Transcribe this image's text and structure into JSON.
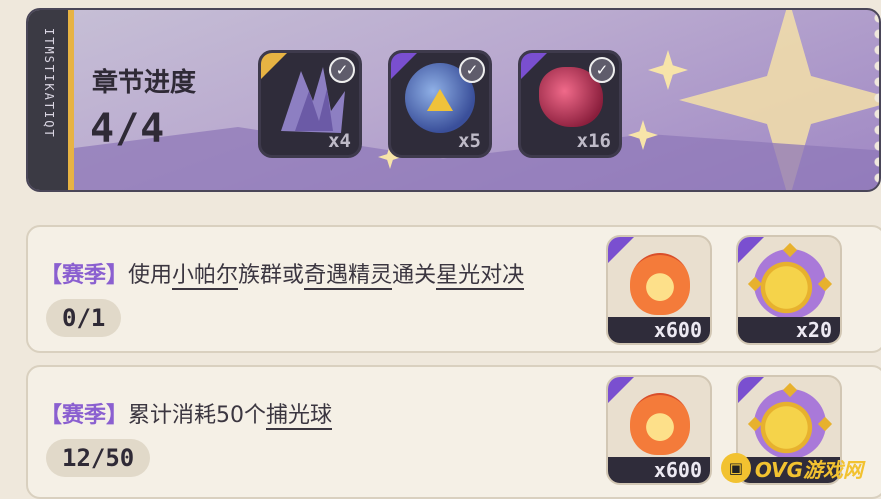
{
  "chapter": {
    "strip_text": "ITMSTIKATIQT",
    "title": "章节进度",
    "progress": "4/4",
    "rewards": [
      {
        "count": "x4",
        "icon": "crystal-dragon-icon",
        "claimed": true
      },
      {
        "count": "x5",
        "icon": "blue-orb-icon",
        "claimed": true
      },
      {
        "count": "x16",
        "icon": "red-gem-icon",
        "claimed": true
      }
    ],
    "check_glyph": "✓"
  },
  "tasks": [
    {
      "tag": "【赛季】",
      "segments": [
        {
          "text": "使用",
          "underline": false
        },
        {
          "text": "小帕尔",
          "underline": true
        },
        {
          "text": "族群或",
          "underline": false
        },
        {
          "text": "奇遇精灵",
          "underline": true
        },
        {
          "text": "通关",
          "underline": false
        },
        {
          "text": "星光对决",
          "underline": true
        }
      ],
      "progress": "0/1",
      "rewards": [
        {
          "icon": "flame-icon",
          "count": "x600"
        },
        {
          "icon": "spiked-coin-icon",
          "count": "x20"
        }
      ]
    },
    {
      "tag": "【赛季】",
      "segments": [
        {
          "text": "累计消耗50个",
          "underline": false
        },
        {
          "text": "捕光球",
          "underline": true
        }
      ],
      "progress": "12/50",
      "rewards": [
        {
          "icon": "flame-icon",
          "count": "x600"
        },
        {
          "icon": "spiked-coin-icon",
          "count": ""
        }
      ]
    }
  ],
  "watermark": {
    "text": "OVG游戏网",
    "icon_text": "▣"
  },
  "colors": {
    "accent": "#8a5fd0",
    "gold": "#e7b343",
    "dark": "#2f2c3a"
  }
}
